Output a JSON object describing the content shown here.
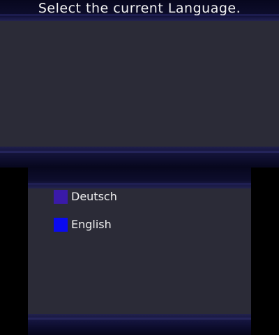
{
  "title": "Select the current Language.",
  "languages": [
    {
      "label": "Deutsch",
      "color": "#3a1aa8"
    },
    {
      "label": "English",
      "color": "#0a0af0"
    }
  ],
  "colors": {
    "background": "#000000",
    "panel": "#2b2b37",
    "bar_dark": "#07071e",
    "bar_accent": "#23234f",
    "text": "#f2f2f2"
  }
}
